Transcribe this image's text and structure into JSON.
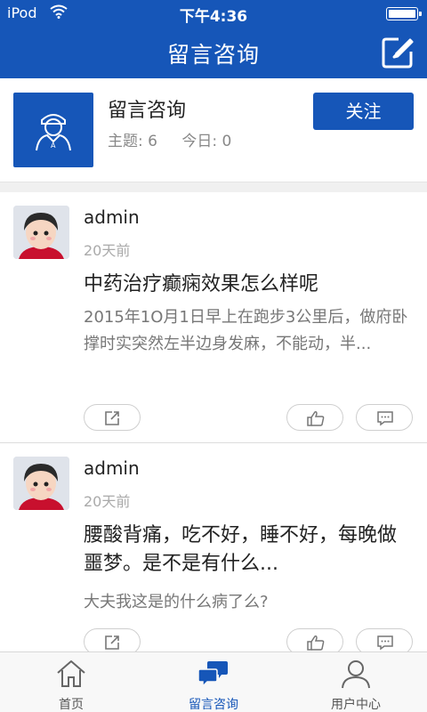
{
  "status_bar": {
    "carrier": "iPod",
    "time": "下午4:36"
  },
  "nav": {
    "title": "留言咨询"
  },
  "forum": {
    "name": "留言咨询",
    "topics": "主题: 6",
    "today": "今日: 0",
    "follow_label": "关注"
  },
  "posts": [
    {
      "author": "admin",
      "time": "20天前",
      "title": "中药治疗癫痫效果怎么样呢",
      "excerpt": "2015年1O月1日早上在跑步3公里后，做府卧撑时实突然左半边身发麻，不能动，半..."
    },
    {
      "author": "admin",
      "time": "20天前",
      "title": "腰酸背痛，吃不好，睡不好，每晚做噩梦。是不是有什么...",
      "excerpt": "大夫我这是的什么病了么?"
    }
  ],
  "tabs": [
    {
      "label": "首页",
      "icon": "home-icon",
      "active": false
    },
    {
      "label": "留言咨询",
      "icon": "chat-icon",
      "active": true
    },
    {
      "label": "用户中心",
      "icon": "user-icon",
      "active": false
    }
  ],
  "colors": {
    "brand": "#1656b8",
    "text": "#222222",
    "muted": "#888888"
  }
}
